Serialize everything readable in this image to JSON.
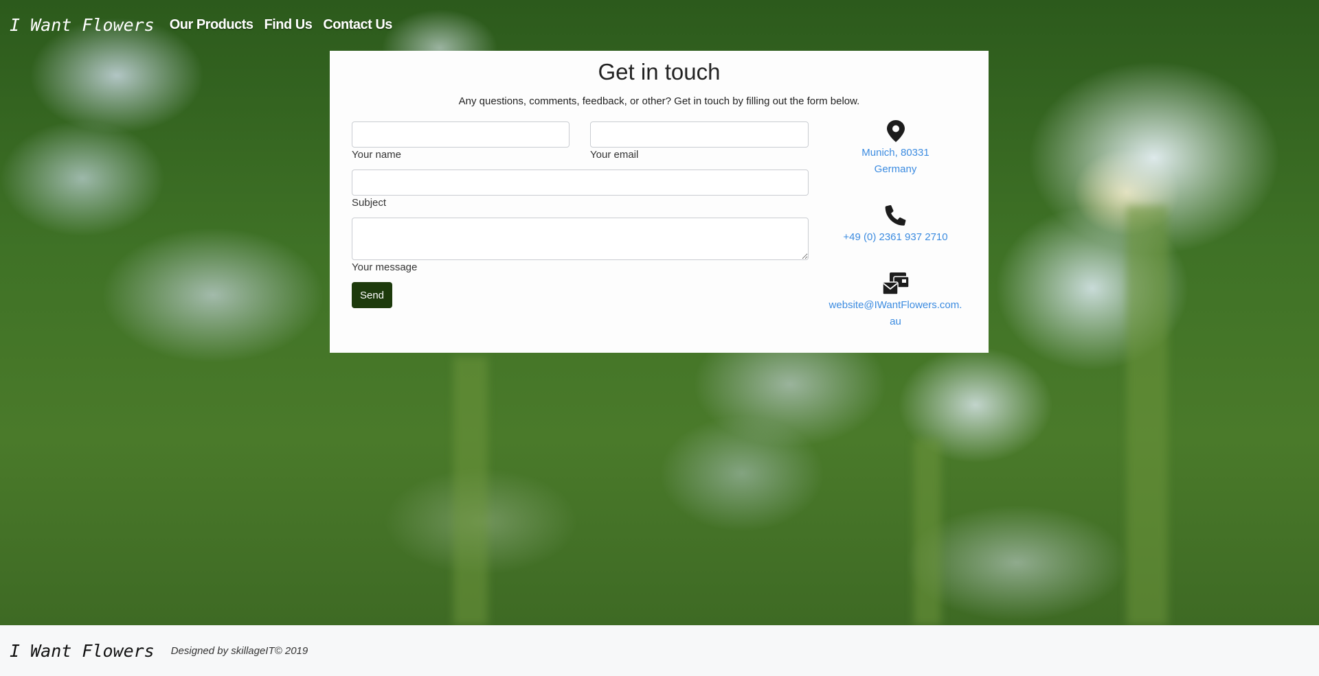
{
  "nav": {
    "brand": "I Want Flowers",
    "links": [
      "Our Products",
      "Find Us",
      "Contact Us"
    ]
  },
  "card": {
    "title": "Get in touch",
    "subtitle": "Any questions, comments, feedback, or other? Get in touch by filling out the form below.",
    "form": {
      "name_label": "Your name",
      "email_label": "Your email",
      "subject_label": "Subject",
      "message_label": "Your message",
      "name_value": "",
      "email_value": "",
      "subject_value": "",
      "message_value": "",
      "send_label": "Send"
    },
    "contact": {
      "location_line1": "Munich, 80331",
      "location_line2": "Germany",
      "phone": "+49 (0) 2361 937 2710",
      "email": "website@IWantFlowers.com.au",
      "icons": [
        "map-marker-icon",
        "phone-icon",
        "mail-bulk-icon"
      ]
    }
  },
  "footer": {
    "brand": "I Want Flowers",
    "credit": "Designed by skillageIT© 2019"
  },
  "colors": {
    "button": "#1d3a0c",
    "link": "#3b8be0",
    "footer_bg": "#f7f8f9"
  }
}
